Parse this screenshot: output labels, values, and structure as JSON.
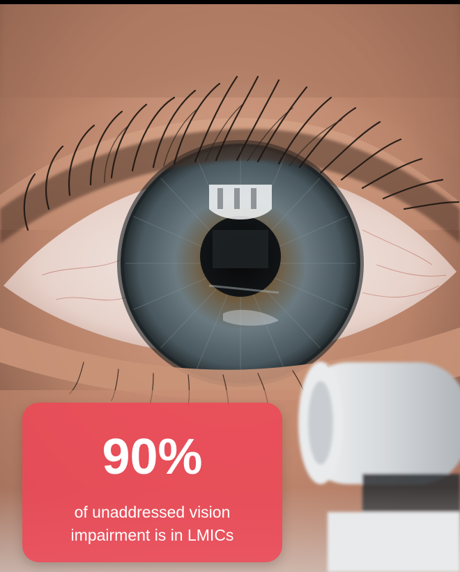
{
  "stat": {
    "value": "90%",
    "caption_lines": [
      "of unaddressed vision",
      "impairment is in LMICs"
    ]
  },
  "colors": {
    "card_background": "#EE4656",
    "card_text": "#FFFFFF",
    "skin": "#C58E73",
    "iris": "#5B6A70"
  },
  "scene": {
    "subject": "close-up-eye-photo",
    "foreground_object": "ophthalmic-instrument"
  }
}
